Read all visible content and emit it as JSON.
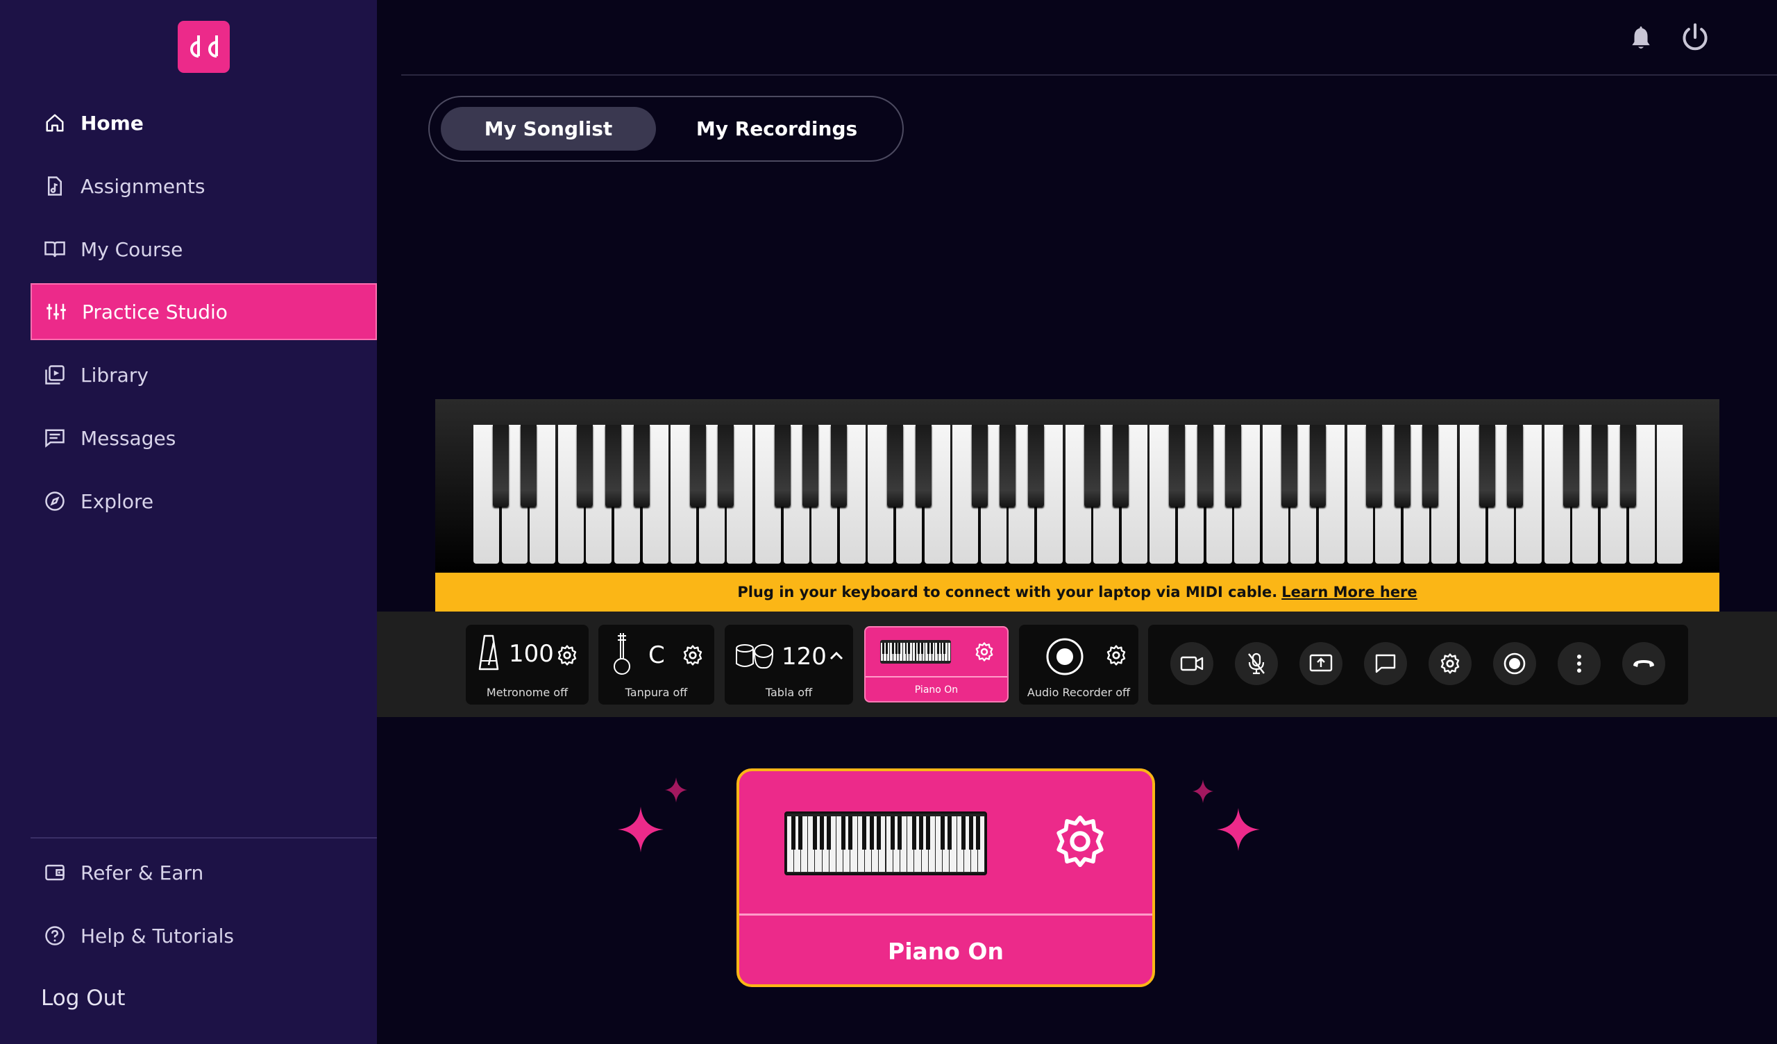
{
  "sidebar": {
    "logo_text": "da",
    "items": [
      {
        "label": "Home",
        "icon": "home-icon"
      },
      {
        "label": "Assignments",
        "icon": "music-file-icon"
      },
      {
        "label": "My Course",
        "icon": "book-icon"
      },
      {
        "label": "Practice Studio",
        "icon": "sliders-icon"
      },
      {
        "label": "Library",
        "icon": "video-library-icon"
      },
      {
        "label": "Messages",
        "icon": "message-icon"
      },
      {
        "label": "Explore",
        "icon": "compass-icon"
      }
    ],
    "bottom_items": [
      {
        "label": "Refer & Earn",
        "icon": "wallet-icon"
      },
      {
        "label": "Help & Tutorials",
        "icon": "help-icon"
      }
    ],
    "logout": "Log Out"
  },
  "header": {
    "icons": [
      "bell-icon",
      "power-icon"
    ]
  },
  "tabs": {
    "songlist": "My Songlist",
    "recordings": "My Recordings",
    "active": "My Songlist"
  },
  "midi_banner": {
    "text": "Plug in your keyboard to connect with your laptop via MIDI cable.",
    "link": "Learn More here"
  },
  "toolbar": {
    "metronome": {
      "value": "100",
      "label": "Metronome off"
    },
    "tanpura": {
      "value": "C",
      "label": "Tanpura off"
    },
    "tabla": {
      "value": "120",
      "label": "Tabla off"
    },
    "piano": {
      "label": "Piano On"
    },
    "audio_recorder": {
      "label": "Audio Recorder off"
    }
  },
  "call_controls": [
    "video-camera-icon",
    "mic-off-icon",
    "screen-share-icon",
    "chat-icon",
    "settings-icon",
    "record-icon",
    "more-vertical-icon",
    "end-call-icon"
  ],
  "piano_card": {
    "label": "Piano On"
  },
  "colors": {
    "sidebar_bg": "#1d1246",
    "page_bg": "#070419",
    "accent_pink": "#ec2a8a",
    "banner_yellow": "#fbb616"
  }
}
